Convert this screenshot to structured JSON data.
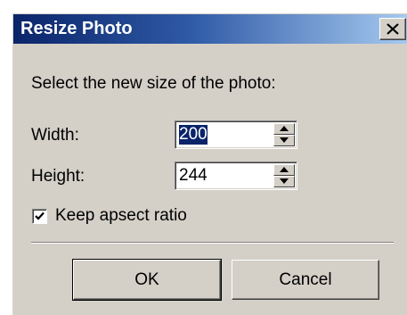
{
  "window": {
    "title": "Resize Photo",
    "close_icon": "close-icon"
  },
  "prompt": "Select the new size of the photo:",
  "fields": {
    "width": {
      "label": "Width:",
      "value": "200",
      "selected": true
    },
    "height": {
      "label": "Height:",
      "value": "244",
      "selected": false
    }
  },
  "aspect": {
    "label": "Keep apsect ratio",
    "checked": true
  },
  "buttons": {
    "ok": "OK",
    "cancel": "Cancel"
  },
  "colors": {
    "title_gradient_start": "#0a246a",
    "title_gradient_end": "#a6caf0",
    "face": "#d4d0c8",
    "selection": "#0a246a"
  }
}
